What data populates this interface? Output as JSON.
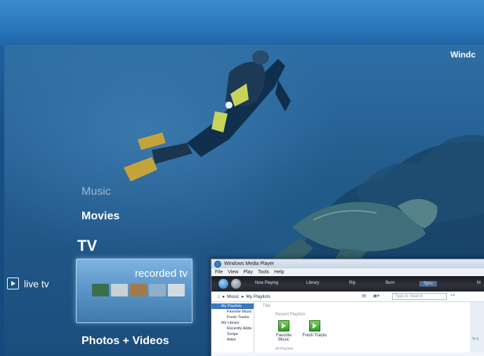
{
  "media_center": {
    "title": "Windc",
    "menu": {
      "music": "Music",
      "movies": "Movies",
      "tv": "TV",
      "photos_videos": "Photos + Videos"
    },
    "tv_strip": {
      "live_tv": "live tv",
      "recorded_tv": "recorded tv"
    }
  },
  "wmp": {
    "title": "Windows Media Player",
    "menubar": [
      "File",
      "View",
      "Play",
      "Tools",
      "Help"
    ],
    "tabs": {
      "now_playing": "Now Playing",
      "library": "Library",
      "rip": "Rip",
      "burn": "Burn",
      "sync": "Sync",
      "more": "M"
    },
    "breadcrumb": {
      "root": "Music",
      "current": "My Playlists"
    },
    "search_placeholder": "Type to Search",
    "tree": {
      "my_playlists": "My Playlists",
      "favorite_music": "Favorite Music",
      "fresh_tracks": "Fresh Tracks",
      "my_library": "My Library",
      "recently_added": "Recently Adde",
      "songs": "Songs",
      "artist": "Artist"
    },
    "column_title": "Title",
    "section_header": "Recent Playlists",
    "playlists": {
      "favorite_music": "Favorite Music",
      "fresh_tracks": "Fresh Tracks"
    },
    "all_playlists": "All Playlists",
    "right_pane_hint": "To b"
  },
  "colors": {
    "accent": "#3a78c2",
    "play_green": "#2f9a28"
  }
}
